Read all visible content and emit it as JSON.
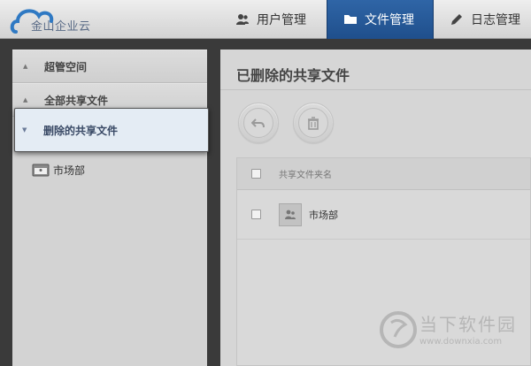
{
  "app": {
    "logo_text": "金山企业云"
  },
  "nav": {
    "items": [
      {
        "label": "用户管理",
        "icon": "users-icon",
        "active": false
      },
      {
        "label": "文件管理",
        "icon": "folder-icon",
        "active": true
      },
      {
        "label": "日志管理",
        "icon": "pencil-icon",
        "active": false
      }
    ]
  },
  "sidebar": {
    "items": [
      {
        "label": "超管空间",
        "expanded": false
      },
      {
        "label": "全部共享文件",
        "expanded": false
      },
      {
        "label": "删除的共享文件",
        "expanded": true,
        "selected": true
      }
    ],
    "tree": [
      {
        "label": "市场部",
        "icon": "shared-folder-icon"
      }
    ]
  },
  "main": {
    "title": "已删除的共享文件",
    "toolbar": [
      {
        "name": "restore",
        "icon": "restore-icon"
      },
      {
        "name": "delete",
        "icon": "trash-icon"
      }
    ],
    "table": {
      "header": "共享文件夹名",
      "rows": [
        {
          "name": "市场部",
          "icon": "shared-folder-icon"
        }
      ]
    }
  },
  "watermark": {
    "text": "当下软件园",
    "url": "www.downxia.com"
  },
  "colors": {
    "accent": "#1f4f8c",
    "selected_bg": "#e4ecf4"
  }
}
